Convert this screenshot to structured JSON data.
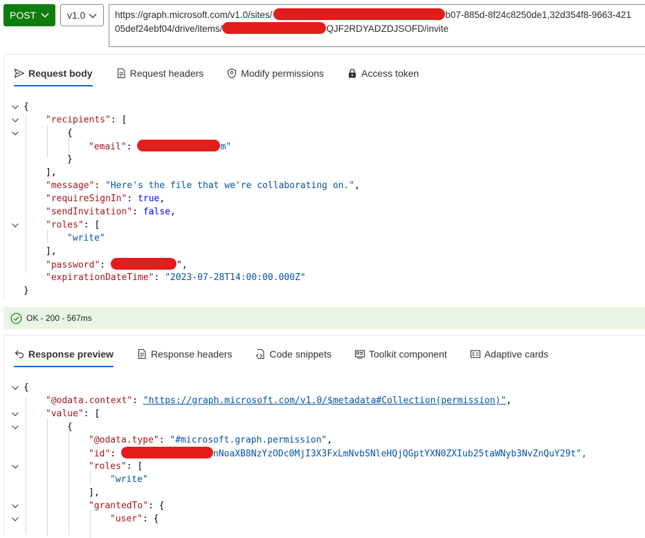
{
  "request": {
    "method": "POST",
    "version": "v1.0",
    "url_line1_prefix": "https://graph.microsoft.com/v1.0/sites/",
    "url_line1_suffix": "b07-885d-8f24c8250de1,32d354f8-9663-421",
    "url_line2_prefix": "05def24ebf04/drive/items/",
    "url_line2_suffix": "QJF2RDYADZDJSOFD/invite"
  },
  "request_tabs": [
    {
      "label": "Request body",
      "icon": "send-icon"
    },
    {
      "label": "Request headers",
      "icon": "document-icon"
    },
    {
      "label": "Modify permissions",
      "icon": "shield-icon"
    },
    {
      "label": "Access token",
      "icon": "lock-icon"
    }
  ],
  "request_body": {
    "open_brace": "{",
    "recipients_key": "\"recipients\"",
    "open_bracket": "[",
    "inner_open_brace": "{",
    "email_key": "\"email\"",
    "email_visible_tail": "m\"",
    "inner_close_brace": "}",
    "close_bracket_comma": "],",
    "message_key": "\"message\"",
    "message_value": "\"Here's the file that we're collaborating on.\"",
    "require_key": "\"requireSignIn\"",
    "require_value": "true",
    "send_key": "\"sendInvitation\"",
    "send_value": "false",
    "roles_key": "\"roles\"",
    "roles_value": "\"write\"",
    "password_key": "\"password\"",
    "password_visible_tail": "\",",
    "expiration_key": "\"expirationDateTime\"",
    "expiration_value": "\"2023-07-28T14:00:00.000Z\"",
    "close_brace": "}"
  },
  "status": {
    "text": "OK - 200 - 567ms"
  },
  "response_tabs": [
    {
      "label": "Response preview",
      "icon": "undo-icon"
    },
    {
      "label": "Response headers",
      "icon": "document-icon"
    },
    {
      "label": "Code snippets",
      "icon": "code-file-icon"
    },
    {
      "label": "Toolkit component",
      "icon": "toolkit-icon"
    },
    {
      "label": "Adaptive cards",
      "icon": "card-icon"
    }
  ],
  "response_body": {
    "open_brace": "{",
    "context_key": "\"@odata.context\"",
    "context_value": "\"https://graph.microsoft.com/v1.0/$metadata#Collection(permission)\"",
    "value_key": "\"value\"",
    "open_bracket": "[",
    "item_open": "{",
    "type_key": "\"@odata.type\"",
    "type_value": "\"#microsoft.graph.permission\"",
    "id_key": "\"id\"",
    "id_visible_tail": "nNoaXB8NzYzODc0MjI3X3FxLmNvbSNleHQjQGptYXN0ZXIub25taWNyb3NvZnQuY29t\",",
    "roles_key": "\"roles\"",
    "roles_value": "\"write\"",
    "granted_key": "\"grantedTo\"",
    "user_key": "\"user\""
  }
}
